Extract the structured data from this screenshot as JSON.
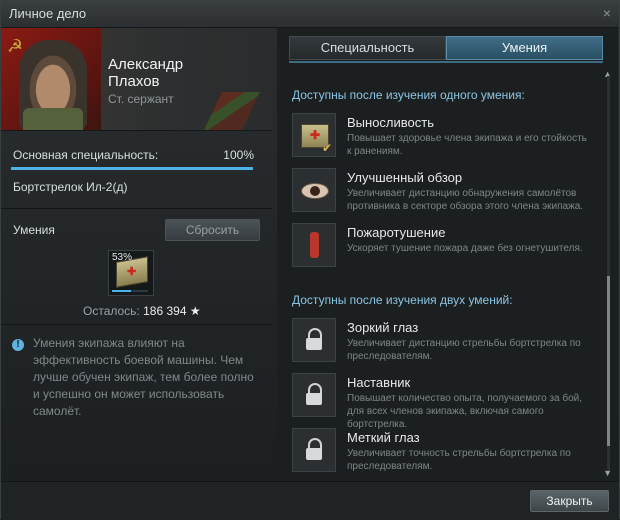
{
  "window": {
    "title": "Личное дело",
    "close_glyph": "×"
  },
  "crew": {
    "first_name": "Александр",
    "last_name": "Плахов",
    "rank": "Ст. сержант",
    "specialization_label": "Основная специальность:",
    "specialization_percent": "100%",
    "specialization_progress": 1.0,
    "specialization_name": "Бортстрелок Ил-2(д)"
  },
  "skills_panel": {
    "title": "Умения",
    "reset_label": "Сбросить",
    "current_skill_percent": "53%",
    "current_skill_progress": 0.53,
    "current_skill_icon": "first-aid-book-icon",
    "remaining_label": "Осталось:",
    "remaining_value": "186 394",
    "remaining_icon": "★",
    "info_icon": "!",
    "info_text": "Умения экипажа влияют на эффективность боевой машины. Чем лучше обучен экипаж, тем более полно и успешно он может использовать самолёт."
  },
  "tabs": [
    {
      "label": "Специальность",
      "active": false
    },
    {
      "label": "Умения",
      "active": true
    }
  ],
  "groups": [
    {
      "title": "Доступны после изучения одного умения:",
      "skills": [
        {
          "name": "Выносливость",
          "desc": "Повышает здоровье члена экипажа и его стойкость к ранениям.",
          "icon": "endurance-book-icon",
          "status": "learning"
        },
        {
          "name": "Улучшенный обзор",
          "desc": "Увеличивает дистанцию обнаружения самолётов противника в секторе обзора этого члена экипажа.",
          "icon": "eye-icon",
          "status": "available"
        },
        {
          "name": "Пожаротушение",
          "desc": "Ускоряет тушение пожара даже без огнетушителя.",
          "icon": "fire-extinguisher-icon",
          "status": "available"
        }
      ]
    },
    {
      "title": "Доступны после изучения двух умений:",
      "skills": [
        {
          "name": "Зоркий глаз",
          "desc": "Увеличивает дистанцию стрельбы бортстрелка по преследователям.",
          "icon": "lock-icon",
          "status": "locked"
        },
        {
          "name": "Наставник",
          "desc": "Повышает количество опыта, получаемого за бой, для всех членов экипажа, включая самого бортстрелка.",
          "icon": "lock-icon",
          "status": "locked"
        },
        {
          "name": "Меткий глаз",
          "desc": "Увеличивает точность стрельбы бортстрелка по преследователям.",
          "icon": "lock-icon",
          "status": "locked"
        }
      ]
    }
  ],
  "footer": {
    "close_label": "Закрыть"
  },
  "colors": {
    "accent": "#4db3e6",
    "group_title": "#8bc5e5",
    "tab_active": "#3f6d86"
  }
}
